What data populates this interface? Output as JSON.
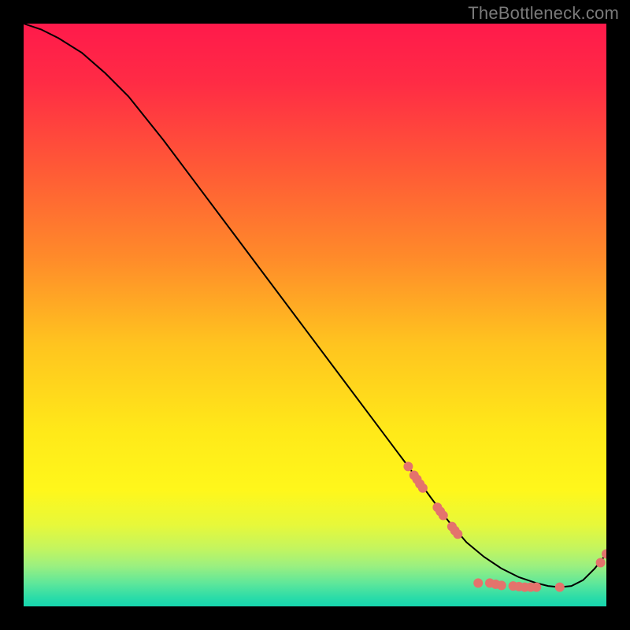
{
  "watermark": "TheBottleneck.com",
  "chart_data": {
    "type": "line",
    "title": "",
    "xlabel": "",
    "ylabel": "",
    "xlim": [
      0,
      100
    ],
    "ylim": [
      0,
      100
    ],
    "grid": false,
    "legend": false,
    "background_gradient_stops": [
      {
        "offset": 0.0,
        "color": "#ff1a4b"
      },
      {
        "offset": 0.1,
        "color": "#ff2b45"
      },
      {
        "offset": 0.25,
        "color": "#ff5a36"
      },
      {
        "offset": 0.4,
        "color": "#ff8a2a"
      },
      {
        "offset": 0.55,
        "color": "#ffc41f"
      },
      {
        "offset": 0.7,
        "color": "#ffe919"
      },
      {
        "offset": 0.8,
        "color": "#fff71b"
      },
      {
        "offset": 0.86,
        "color": "#e7f83a"
      },
      {
        "offset": 0.9,
        "color": "#c4f55e"
      },
      {
        "offset": 0.93,
        "color": "#9cf07f"
      },
      {
        "offset": 0.96,
        "color": "#5fe79a"
      },
      {
        "offset": 0.985,
        "color": "#2bdca8"
      },
      {
        "offset": 1.0,
        "color": "#16d6ae"
      }
    ],
    "series": [
      {
        "name": "bottleneck-curve",
        "color": "#000000",
        "x": [
          0,
          3,
          6,
          10,
          14,
          18,
          24,
          30,
          36,
          42,
          48,
          54,
          60,
          66,
          70,
          73,
          76,
          79,
          82,
          85,
          88,
          90,
          92,
          94,
          96,
          98,
          100
        ],
        "y": [
          100,
          99,
          97.5,
          95,
          91.5,
          87.5,
          80,
          72,
          64,
          56,
          48,
          40,
          32,
          24,
          18.5,
          14.5,
          11,
          8.5,
          6.5,
          5,
          4,
          3.5,
          3.3,
          3.5,
          4.5,
          6.5,
          9
        ]
      }
    ],
    "scatter": [
      {
        "name": "bottleneck-markers",
        "color": "#e4736c",
        "radius": 6,
        "points": [
          {
            "x": 66,
            "y": 24
          },
          {
            "x": 67,
            "y": 22.5
          },
          {
            "x": 67.5,
            "y": 21.8
          },
          {
            "x": 68,
            "y": 21
          },
          {
            "x": 68.5,
            "y": 20.3
          },
          {
            "x": 71,
            "y": 17
          },
          {
            "x": 71.5,
            "y": 16.3
          },
          {
            "x": 72,
            "y": 15.6
          },
          {
            "x": 73.5,
            "y": 13.7
          },
          {
            "x": 74,
            "y": 13
          },
          {
            "x": 74.5,
            "y": 12.4
          },
          {
            "x": 78,
            "y": 4
          },
          {
            "x": 80,
            "y": 4
          },
          {
            "x": 81,
            "y": 3.8
          },
          {
            "x": 82,
            "y": 3.6
          },
          {
            "x": 84,
            "y": 3.5
          },
          {
            "x": 85,
            "y": 3.4
          },
          {
            "x": 86,
            "y": 3.3
          },
          {
            "x": 87,
            "y": 3.3
          },
          {
            "x": 88,
            "y": 3.3
          },
          {
            "x": 92,
            "y": 3.3
          },
          {
            "x": 99,
            "y": 7.5
          },
          {
            "x": 100,
            "y": 9
          }
        ]
      }
    ]
  }
}
